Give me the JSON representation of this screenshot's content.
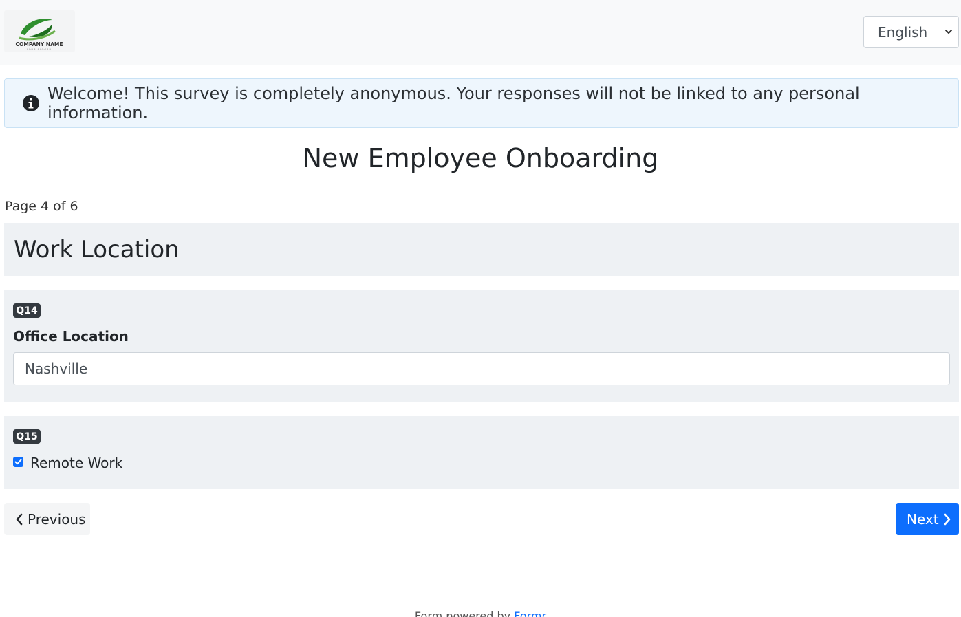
{
  "header": {
    "logo": {
      "name": "COMPANY NAME",
      "slogan": "YOUR SLOGAN"
    },
    "language": {
      "selected": "English"
    }
  },
  "alert": {
    "icon": "info-circle-icon",
    "text": "Welcome! This survey is completely anonymous. Your responses will not be linked to any personal information."
  },
  "survey": {
    "title": "New Employee Onboarding",
    "page_indicator": "Page 4 of 6",
    "section_title": "Work Location",
    "questions": [
      {
        "badge": "Q14",
        "label": "Office Location",
        "value": "Nashville"
      },
      {
        "badge": "Q15",
        "label": "Remote Work",
        "checked": true
      }
    ]
  },
  "nav": {
    "previous_label": "Previous",
    "next_label": "Next"
  },
  "footer": {
    "prefix": "Form powered by",
    "link": "Formr"
  },
  "colors": {
    "primary": "#0d6efd",
    "badge": "#343a40",
    "card_bg": "#eef1f4",
    "alert_bg": "#eef6fd"
  }
}
